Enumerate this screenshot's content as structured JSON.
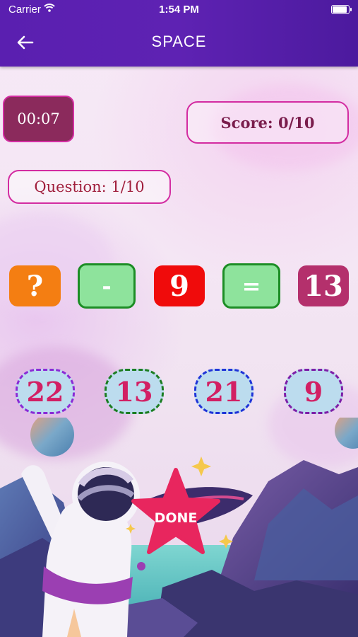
{
  "status_bar": {
    "carrier": "Carrier",
    "time": "1:54 PM"
  },
  "app_bar": {
    "title": "SPACE",
    "back_icon": "arrow-left-icon"
  },
  "game": {
    "timer": "00:07",
    "score": "Score: 0/10",
    "question": "Question: 1/10",
    "equation": {
      "operand_1": "?",
      "operator": "-",
      "operand_2": "9",
      "equals": "=",
      "result": "13"
    },
    "choices": [
      "22",
      "13",
      "21",
      "9"
    ],
    "done_label": "DONE"
  },
  "colors": {
    "app_bar": "#5a1fb0",
    "accent_pink": "#d32ca1",
    "timer_bg": "#8b2a5c",
    "unknown_tile": "#f47e12",
    "operator_tile": "#8ee39c",
    "operand_tile": "#f00b0b",
    "result_tile": "#b4306c",
    "choice_bg": "#bcdcee",
    "choice_text": "#d21f63",
    "done_star": "#e8265e"
  }
}
